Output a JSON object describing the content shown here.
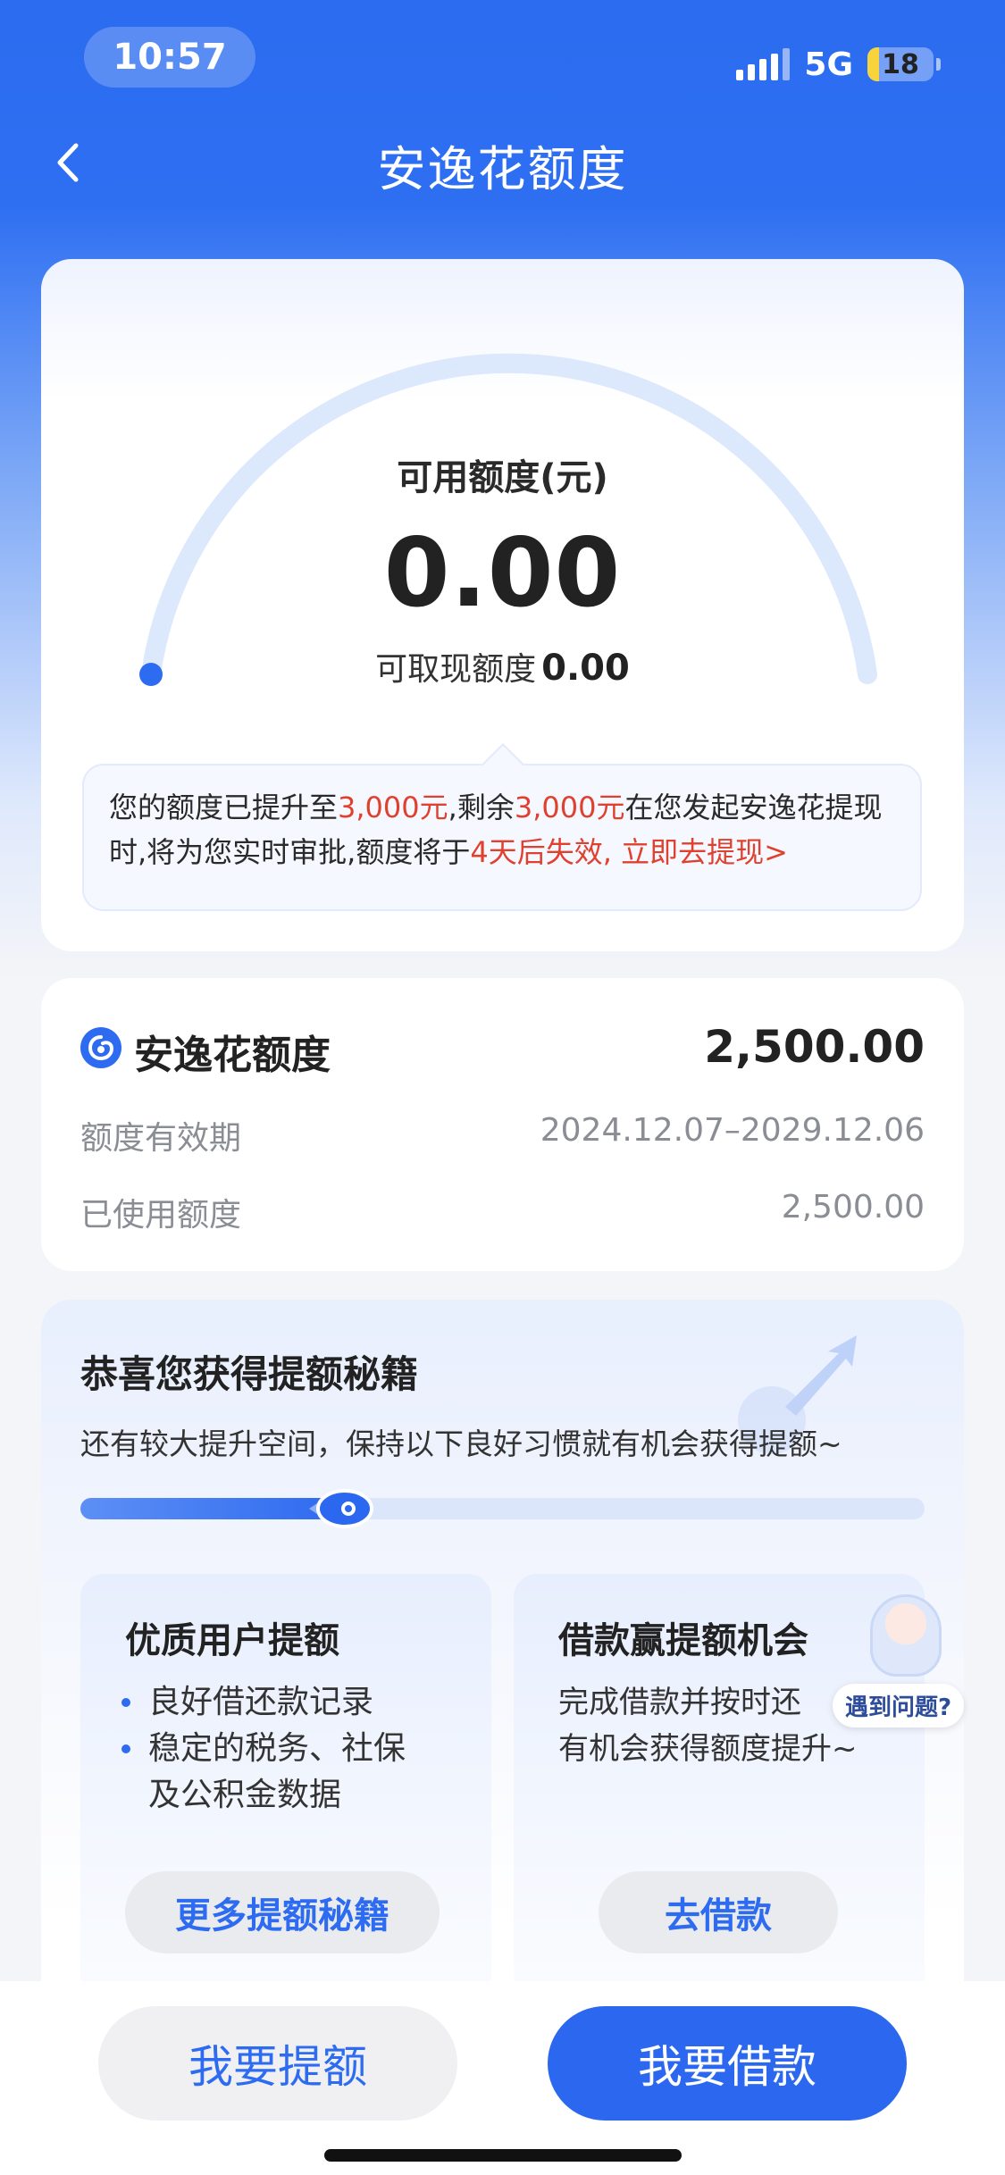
{
  "status_bar": {
    "time": "10:57",
    "network": "5G",
    "battery": "18",
    "battery_level": 0.18
  },
  "nav": {
    "title": "安逸花额度"
  },
  "quota_card": {
    "label": "可用额度(元)",
    "value": "0.00",
    "cash_label": "可取现额度",
    "cash_value": "0.00",
    "notice": {
      "p1": "您的额度已提升至",
      "amount1": "3,000元",
      "p2": ",剩余",
      "amount2": "3,000元",
      "p3": "在您发起安逸花提现时,将为您实时审批,额度将于",
      "expire": "4天后失效,",
      "link": "立即去提现>"
    },
    "colors": {
      "accent": "#2d6cf0",
      "highlight": "#e0412e"
    }
  },
  "credit_card": {
    "title": "安逸花额度",
    "amount": "2,500.00",
    "rows": [
      {
        "label": "额度有效期",
        "value": "2024.12.07–2029.12.06"
      },
      {
        "label": "已使用额度",
        "value": "2,500.00"
      }
    ]
  },
  "tips_card": {
    "title": "恭喜您获得提额秘籍",
    "subtitle": "还有较大提升空间，保持以下良好习惯就有机会获得提额~",
    "progress": 0.33,
    "left": {
      "title": "优质用户提额",
      "items": [
        "良好借还款记录",
        "稳定的税务、社保",
        "及公积金数据"
      ],
      "button": "更多提额秘籍"
    },
    "right": {
      "title": "借款赢提额机会",
      "text_line1": "完成借款并按时还",
      "text_line2": "有机会获得额度提升~",
      "button": "去借款"
    }
  },
  "helper": {
    "label": "遇到问题?"
  },
  "bottom": {
    "left_button": "我要提额",
    "right_button": "我要借款"
  }
}
